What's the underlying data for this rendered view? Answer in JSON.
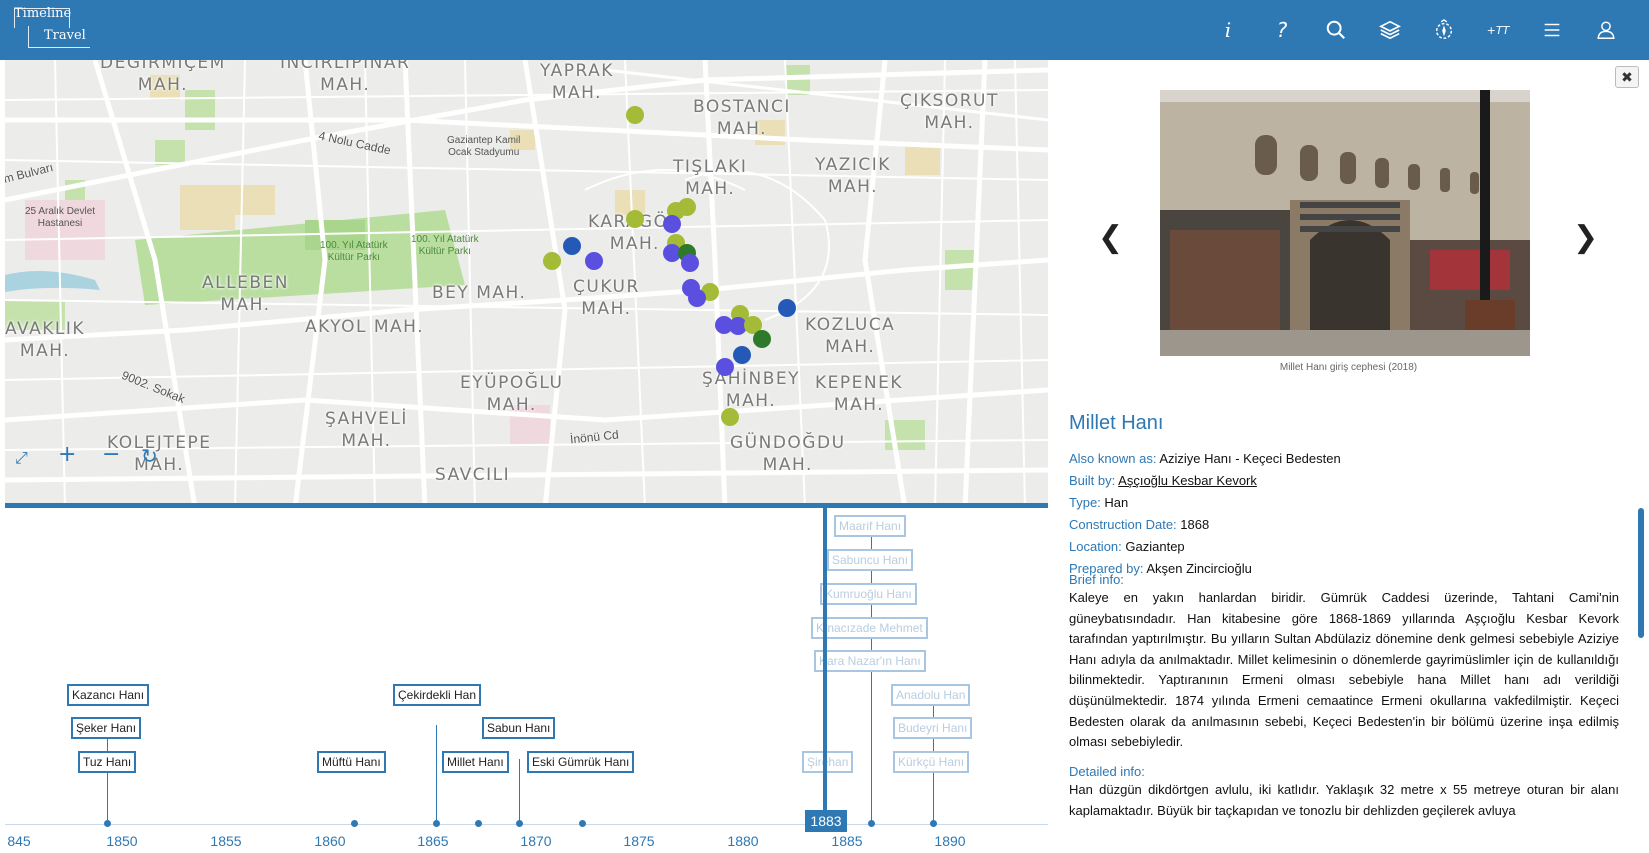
{
  "header": {
    "logo_line1": "Timeline",
    "logo_line2": "Travel",
    "icons": [
      {
        "name": "info-icon",
        "glyph": "i"
      },
      {
        "name": "help-icon",
        "glyph": "?"
      },
      {
        "name": "search-icon",
        "glyph": ""
      },
      {
        "name": "layers-icon",
        "glyph": ""
      },
      {
        "name": "compass-icon",
        "glyph": ""
      },
      {
        "name": "text-size-icon",
        "glyph": "+TT"
      },
      {
        "name": "menu-icon",
        "glyph": "≡"
      },
      {
        "name": "user-icon",
        "glyph": ""
      }
    ],
    "bg_color": "#2e78b4"
  },
  "map": {
    "neighborhoods": [
      {
        "text": "DEĞİRMİÇEM\nMAH."
      },
      {
        "text": "İNCİRLİPINAR\nMAH."
      },
      {
        "text": "YAPRAK\nMAH."
      },
      {
        "text": "BOSTANCI\nMAH."
      },
      {
        "text": "ÇIKSORUT\nMAH."
      },
      {
        "text": "TIŞLAKI\nMAH."
      },
      {
        "text": "YAZICIK\nMAH."
      },
      {
        "text": "KARAGÖZ\nMAH."
      },
      {
        "text": "ALLEBEN\nMAH."
      },
      {
        "text": "BEY MAH."
      },
      {
        "text": "ÇUKUR\nMAH."
      },
      {
        "text": "KOZLUCA\nMAH."
      },
      {
        "text": "AVAKLIK\nMAH."
      },
      {
        "text": "AKYOL MAH."
      },
      {
        "text": "EYÜPOĞLU\nMAH."
      },
      {
        "text": "ŞAHİNBEY\nMAH."
      },
      {
        "text": "KEPENEK\nMAH."
      },
      {
        "text": "ŞAHVELİ\nMAH."
      },
      {
        "text": "KOLEJTEPE\nMAH."
      },
      {
        "text": "GÜNDOĞDU\nMAH."
      },
      {
        "text": "SAVCILI"
      }
    ],
    "streets": [
      "4 Nolu Cadde",
      "m Bulvarı",
      "9002. Sokak",
      "İnönü Cd"
    ],
    "pois": [
      {
        "text": "Gaziantep Kamil\nOcak Stadyumu"
      },
      {
        "text": "25 Aralık Devlet\nHastanesi"
      },
      {
        "text": "100. Yıl Atatürk\nKültür Parkı"
      },
      {
        "text": "100. Yıl Atatürk\nKültür Parkı"
      }
    ],
    "marker_colors": {
      "olive": "#a4bb37",
      "purple": "#5b4fe0",
      "blue": "#2459b8",
      "green": "#2f7a2a"
    },
    "controls": [
      "expand-icon",
      "zoom-in-icon",
      "zoom-out-icon",
      "rotate-icon"
    ]
  },
  "timeline": {
    "ticks": [
      "845",
      "1850",
      "1855",
      "1860",
      "1865",
      "1870",
      "1875",
      "1880",
      "1885",
      "1890"
    ],
    "current_year": "1883",
    "events": [
      {
        "label": "Kazancı Hanı",
        "faded": false
      },
      {
        "label": "Şeker Hanı",
        "faded": false
      },
      {
        "label": "Tuz Hanı",
        "faded": false
      },
      {
        "label": "Çekirdekli Han",
        "faded": false
      },
      {
        "label": "Sabun Hanı",
        "faded": false
      },
      {
        "label": "Müftü Hanı",
        "faded": false
      },
      {
        "label": "Millet Hanı",
        "faded": false
      },
      {
        "label": "Eski Gümrük Hanı",
        "faded": false
      },
      {
        "label": "Maarif Hanı",
        "faded": true
      },
      {
        "label": "Sabuncu Hanı",
        "faded": true
      },
      {
        "label": "Kumruoğlu Hanı",
        "faded": true
      },
      {
        "label": "Kınacızade Mehmet",
        "faded": true
      },
      {
        "label": "Kara Nazar'ın Hanı",
        "faded": true
      },
      {
        "label": "Anadolu Han",
        "faded": true
      },
      {
        "label": "Budeyri Hanı",
        "faded": true
      },
      {
        "label": "Şirehan",
        "faded": true
      },
      {
        "label": "Kürkçü Hanı",
        "faded": true
      }
    ]
  },
  "panel": {
    "close_glyph": "✖",
    "prev_glyph": "❮",
    "next_glyph": "❯",
    "photo_caption": "Millet Hanı giriş cephesi (2018)",
    "title": "Millet Hanı",
    "fields": {
      "aka_label": "Also known as:",
      "aka_value": "Aziziye Hanı - Keçeci Bedesten",
      "built_label": "Built by:",
      "built_value": "Aşçıoğlu Kesbar Kevork",
      "type_label": "Type:",
      "type_value": "Han",
      "date_label": "Construction Date:",
      "date_value": "1868",
      "location_label": "Location:",
      "location_value": "Gaziantep",
      "prepared_label": "Prepared by:",
      "prepared_value": "Akşen Zincircioğlu"
    },
    "brief_heading": "Brief info:",
    "brief_text": "Kaleye en yakın hanlardan biridir. Gümrük Caddesi üzerinde, Tahtani Cami'nin güneybatısındadır. Han kitabesine göre 1868-1869 yıllarında Aşçıoğlu Kesbar Kevork tarafından yaptırılmıştır. Bu yılların Sultan Abdülaziz dönemine denk gelmesi sebebiyle Aziziye Hanı adıyla da anılmaktadır. Millet kelimesinin o dönemlerde gayrimüslimler için de kullanıldığı bilinmektedir. Yaptıranının Ermeni olması sebebiyle hana Millet hanı adı verildiği düşünülmektedir. 1874 yılında Ermeni cemaatince Ermeni okullarına vakfedilmiştir. Keçeci Bedesten olarak da anılmasının sebebi, Keçeci Bedesten'in bir bölümü üzerine inşa edilmiş olması sebebiyledir.",
    "detailed_heading": "Detailed info:",
    "detailed_text": "Han düzgün dikdörtgen avlulu, iki katlıdır. Yaklaşık 32 metre x 55 metreye oturan bir alanı kaplamaktadır. Büyük bir taçkapıdan ve tonozlu bir dehlizden geçilerek avluya"
  }
}
